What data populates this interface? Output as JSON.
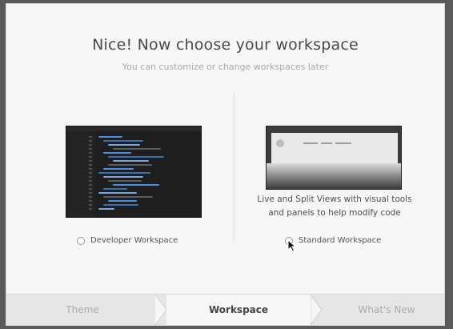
{
  "header": {
    "title": "Nice! Now choose your workspace",
    "subtitle": "You can customize or change workspaces later"
  },
  "workspaces": {
    "developer": {
      "label": "Developer Workspace",
      "selected": false
    },
    "standard": {
      "label": "Standard Workspace",
      "description_line1": "Live and Split Views with visual tools",
      "description_line2": "and panels to help modify code",
      "selected": false
    }
  },
  "steps": [
    {
      "label": "Theme",
      "state": "done"
    },
    {
      "label": "Workspace",
      "state": "active"
    },
    {
      "label": "What's New",
      "state": "pending"
    }
  ],
  "icons": {
    "cursor": "mouse-pointer-icon"
  },
  "colors": {
    "background": "#f6f6f6",
    "title": "#4a4a4a",
    "subtitle": "#a9a9a9",
    "active_step": "#444444",
    "inactive_step": "#aaaaaa",
    "code_bg": "#1e1e1e",
    "code_accent": "#4a90e2"
  }
}
